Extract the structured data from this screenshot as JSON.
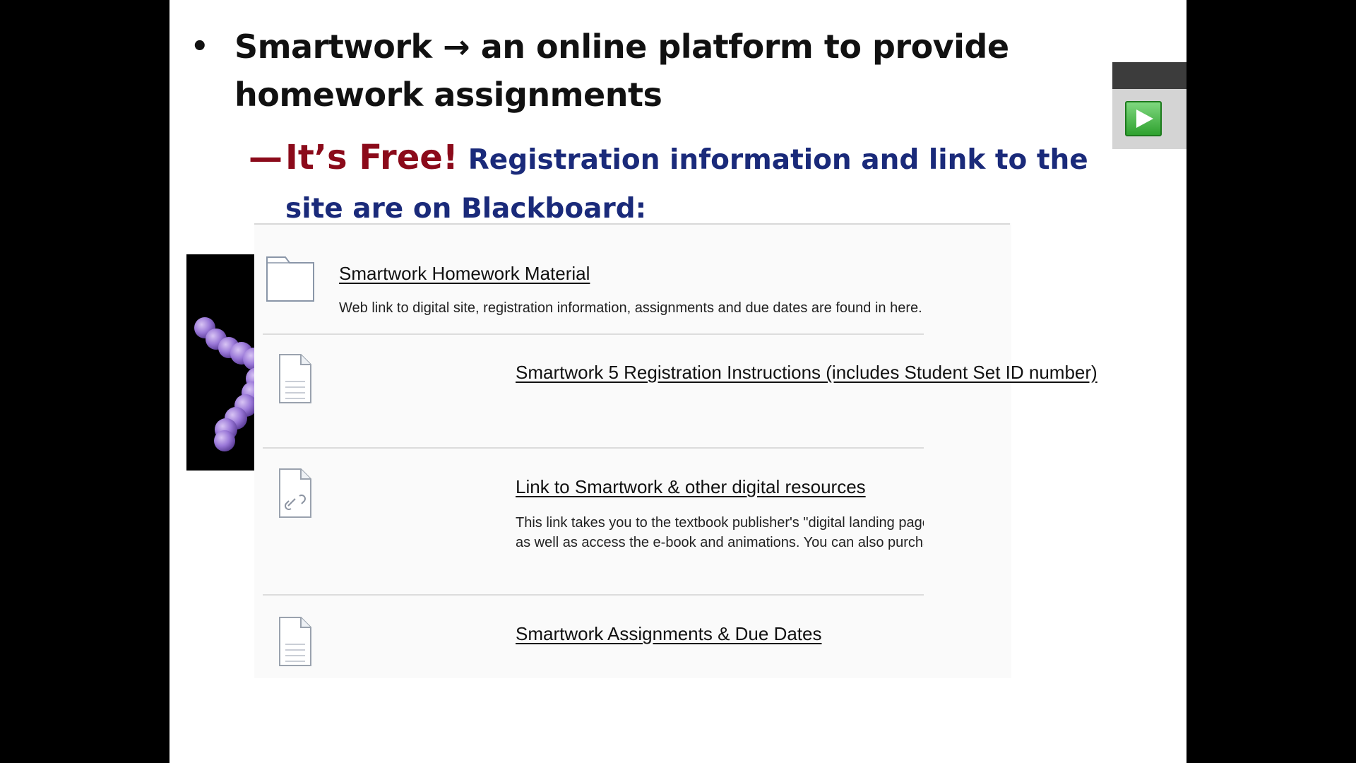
{
  "slide": {
    "bullet_symbol": "•",
    "bullet_text": "Smartwork → an online platform to provide homework assignments",
    "sub_dash": "—",
    "free_text": "It’s Free!",
    "registration_text": "Registration information and link to the site are on Blackboard:"
  },
  "image": {
    "icon": "bacteria-image"
  },
  "blackboard": {
    "items": [
      {
        "icon": "folder-icon",
        "title": "Smartwork Homework Material",
        "description": "Web link to digital site, registration information, assignments and due dates are found in here."
      },
      {
        "icon": "document-icon",
        "title": "Smartwork 5 Registration Instructions (includes Student Set ID number)"
      },
      {
        "icon": "link-document-icon",
        "title": "Link to Smartwork & other digital resources",
        "description_line1": "This link takes you to the textbook publisher's \"digital landing page\" where you can access the",
        "description_line2": "as well as access the e-book and animations.  You can also purchase the e-book and/or Smar"
      },
      {
        "icon": "document-icon",
        "title": "Smartwork Assignments & Due Dates"
      }
    ]
  },
  "player": {
    "play_icon": "play-icon",
    "accent": "#2fa12f"
  }
}
